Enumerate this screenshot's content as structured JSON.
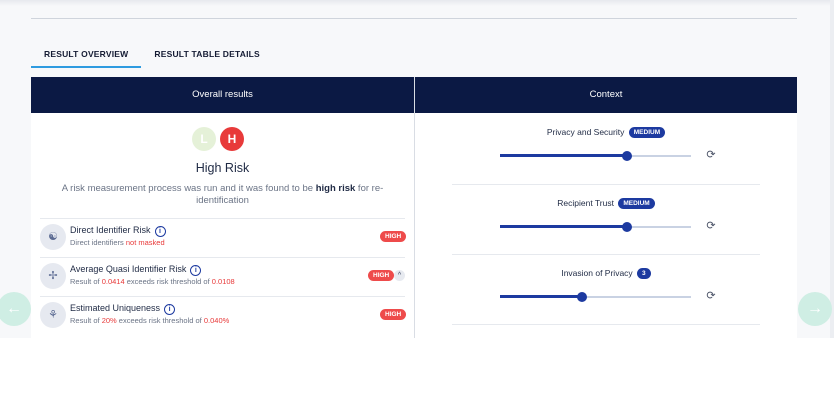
{
  "tabs": [
    {
      "label": "RESULT OVERVIEW",
      "active": true
    },
    {
      "label": "RESULT TABLE DETAILS",
      "active": false
    }
  ],
  "overall": {
    "header": "Overall results",
    "badge_low": "L",
    "badge_high": "H",
    "risk_title": "High Risk",
    "desc_prefix": "A risk measurement process was run and it was found to be ",
    "desc_bold": "high risk",
    "desc_suffix": " for re-identification",
    "rows": [
      {
        "title": "Direct Identifier Risk",
        "sub_prefix": "Direct identifiers ",
        "sub_highlight": "not masked",
        "badge": "HIGH"
      },
      {
        "title": "Average Quasi Identifier Risk",
        "sub_prefix": "Result of ",
        "sub_val1": "0.0414",
        "sub_mid": " exceeds risk threshold of ",
        "sub_val2": "0.0108",
        "badge": "HIGH"
      },
      {
        "title": "Estimated Uniqueness",
        "sub_prefix": "Result of ",
        "sub_val1": "20%",
        "sub_mid": " exceeds risk threshold of ",
        "sub_val2": "0.040%",
        "badge": "HIGH"
      }
    ],
    "info_glyph": "i"
  },
  "context": {
    "header": "Context",
    "items": [
      {
        "label": "Privacy and Security",
        "pill": "MEDIUM",
        "value_fraction": 0.665
      },
      {
        "label": "Recipient Trust",
        "pill": "MEDIUM",
        "value_fraction": 0.665
      },
      {
        "label": "Invasion of Privacy",
        "pill": "3",
        "value_fraction": 0.43
      }
    ]
  },
  "colors": {
    "navy_header": "#0b1944",
    "high_red": "#e83a3a",
    "accent_blue": "#1d3aa0",
    "tab_underline": "#2e9be0",
    "nav_mint": "#cfeee4"
  },
  "icons": {
    "prev": "arrow-left-icon",
    "next": "arrow-right-icon",
    "reset": "refresh-icon"
  }
}
